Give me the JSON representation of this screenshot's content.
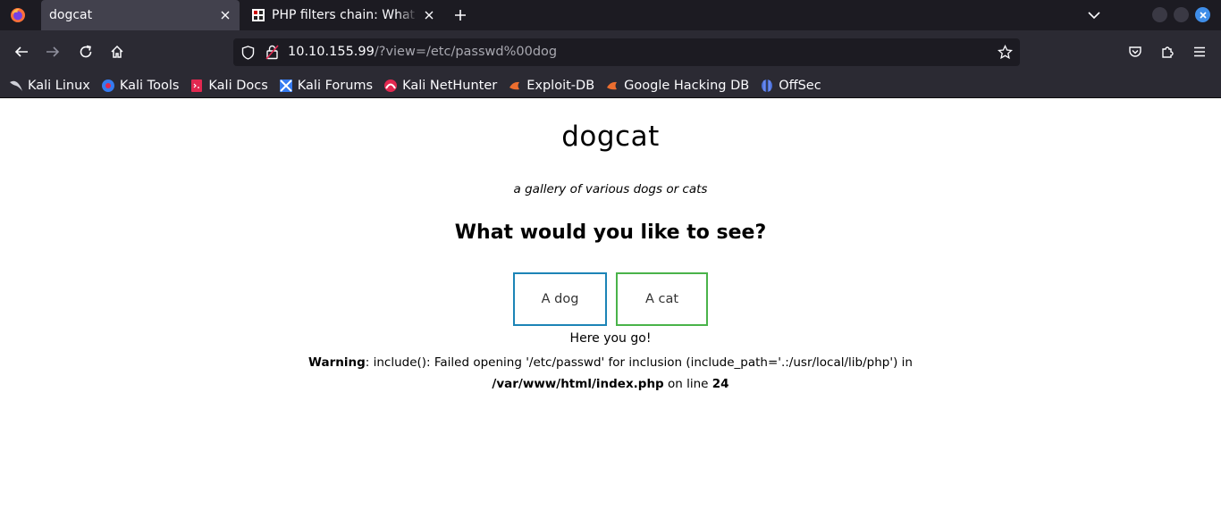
{
  "tabs": [
    {
      "title": "dogcat",
      "active": true
    },
    {
      "title": "PHP filters chain: What is",
      "active": false
    }
  ],
  "url": {
    "host": "10.10.155.99",
    "path": "/?view=/etc/passwd%00dog"
  },
  "bookmarks": [
    {
      "label": "Kali Linux",
      "icon": "kali-linux-icon"
    },
    {
      "label": "Kali Tools",
      "icon": "kali-tools-icon"
    },
    {
      "label": "Kali Docs",
      "icon": "kali-docs-icon"
    },
    {
      "label": "Kali Forums",
      "icon": "kali-forums-icon"
    },
    {
      "label": "Kali NetHunter",
      "icon": "kali-nethunter-icon"
    },
    {
      "label": "Exploit-DB",
      "icon": "exploit-db-icon"
    },
    {
      "label": "Google Hacking DB",
      "icon": "google-hacking-db-icon"
    },
    {
      "label": "OffSec",
      "icon": "offsec-icon"
    }
  ],
  "page": {
    "title": "dogcat",
    "subtitle": "a gallery of various dogs or cats",
    "question": "What would you like to see?",
    "dog_button": "A dog",
    "cat_button": "A cat",
    "result": "Here you go!",
    "warning": {
      "label": "Warning",
      "message": ": include(): Failed opening '/etc/passwd' for inclusion (include_path='.:/usr/local/lib/php') in ",
      "file": "/var/www/html/index.php",
      "on_line": " on line ",
      "line": "24"
    }
  },
  "colors": {
    "dog_border": "#1c84b6",
    "cat_border": "#4ab34a",
    "accent": "#3f8ee9"
  }
}
